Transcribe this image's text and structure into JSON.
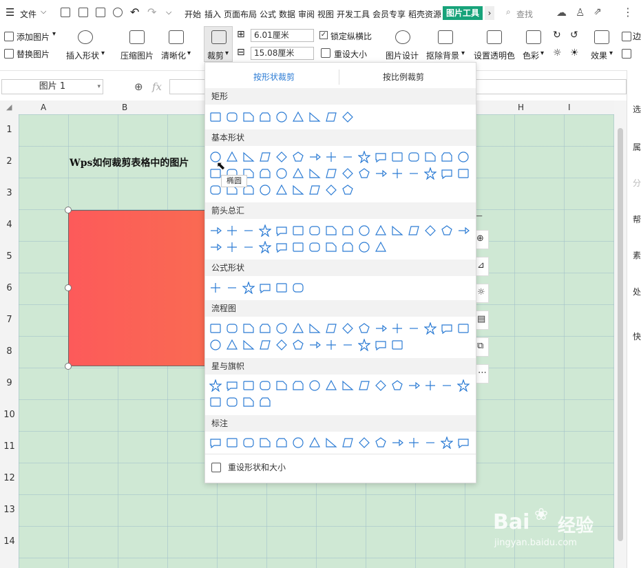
{
  "menubar": {
    "file_label": "文件",
    "tabs": [
      "开始",
      "插入",
      "页面布局",
      "公式",
      "数据",
      "审阅",
      "视图",
      "开发工具",
      "会员专享",
      "稻壳资源"
    ],
    "active_tab": "图片工具",
    "search_label": "查找"
  },
  "ribbon": {
    "add_picture": "添加图片",
    "replace_picture": "替换图片",
    "insert_shape": "插入形状",
    "compress_picture": "压缩图片",
    "sharpen": "清晰化",
    "crop": "裁剪",
    "width_value": "6.01厘米",
    "height_value": "15.08厘米",
    "lock_ratio": "锁定纵横比",
    "reset_size": "重设大小",
    "picture_design": "图片设计",
    "remove_background": "抠除背景",
    "set_transparency": "设置透明色",
    "color": "色彩",
    "effects": "效果",
    "border_cut": "边"
  },
  "formula_bar": {
    "name_box": "图片 1",
    "fx": "fx"
  },
  "sheet": {
    "columns": [
      "A",
      "B",
      "H",
      "I"
    ],
    "rows": [
      "1",
      "2",
      "3",
      "4",
      "5",
      "6",
      "7",
      "8",
      "9",
      "10",
      "11",
      "12",
      "13",
      "14"
    ],
    "cell_text": "Wps如何裁剪表格中的图片",
    "fill_color": "#cfe8d4",
    "shape_color": "#fd5a5a"
  },
  "sidebar": {
    "items": [
      "选",
      "属",
      "分",
      "帮",
      "素",
      "处",
      "快"
    ]
  },
  "dropdown": {
    "tab_shape_crop": "按形状裁剪",
    "tab_ratio_crop": "按比例裁剪",
    "sections": [
      "矩形",
      "基本形状",
      "箭头总汇",
      "公式形状",
      "流程图",
      "星与旗帜",
      "标注"
    ],
    "tooltip": "椭圆",
    "reset_label": "重设形状和大小",
    "accent_color": "#2b7bd4"
  },
  "watermark": {
    "brand": "Bai",
    "brand_cn": "经验",
    "url": "jingyan.baidu.com"
  }
}
